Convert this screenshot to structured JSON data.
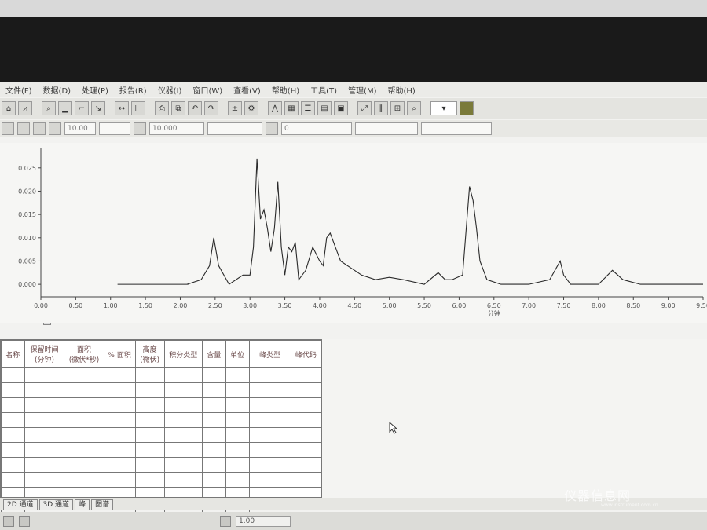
{
  "menu": [
    "文件(F)",
    "数据(D)",
    "处理(P)",
    "报告(R)",
    "仪器(I)",
    "窗口(W)",
    "查看(V)",
    "帮助(H)",
    "工具(T)",
    "管理(M)",
    "帮助(H)"
  ],
  "toolbar2": {
    "field1": "10.00",
    "field2": "10.000",
    "field3": "0"
  },
  "chart_data": {
    "type": "line",
    "xlabel": "分钟",
    "x_ticks": [
      "0.00",
      "0.50",
      "1.00",
      "1.50",
      "2.00",
      "2.50",
      "3.00",
      "3.50",
      "4.00",
      "4.50",
      "5.00",
      "5.50",
      "6.00",
      "6.50",
      "7.00",
      "7.50",
      "8.00",
      "8.50",
      "9.00",
      "9.50"
    ],
    "y_ticks": [
      "0.025",
      "0.020",
      "0.015",
      "0.010",
      "0.005",
      "0.000"
    ],
    "xlim": [
      0,
      9.5
    ],
    "ylim": [
      -0.002,
      0.028
    ],
    "series": [
      {
        "x": [
          2.1,
          2.3,
          2.42,
          2.48,
          2.55,
          2.7,
          2.9,
          3.0,
          3.05,
          3.1,
          3.15,
          3.2,
          3.25,
          3.3,
          3.35,
          3.4,
          3.45,
          3.5,
          3.55,
          3.6,
          3.65,
          3.7,
          3.8,
          3.9,
          4.0,
          4.05,
          4.1,
          4.15,
          4.2,
          4.25,
          4.3,
          4.4,
          4.5,
          4.6,
          4.8,
          5.0,
          5.2,
          5.5,
          5.7,
          5.8,
          5.9,
          6.05,
          6.15,
          6.2,
          6.25,
          6.3,
          6.4,
          6.6,
          6.8,
          7.0,
          7.3,
          7.45,
          7.5,
          7.6,
          7.8,
          8.0,
          8.2,
          8.35,
          8.6,
          9.0,
          9.5
        ],
        "y": [
          0.0,
          0.001,
          0.004,
          0.01,
          0.004,
          0.0,
          0.002,
          0.002,
          0.008,
          0.027,
          0.014,
          0.016,
          0.012,
          0.007,
          0.012,
          0.022,
          0.008,
          0.002,
          0.008,
          0.007,
          0.009,
          0.001,
          0.003,
          0.008,
          0.005,
          0.004,
          0.01,
          0.011,
          0.009,
          0.007,
          0.005,
          0.004,
          0.003,
          0.002,
          0.001,
          0.0015,
          0.001,
          0.0,
          0.0025,
          0.001,
          0.001,
          0.002,
          0.021,
          0.018,
          0.012,
          0.005,
          0.001,
          0.0,
          0.0,
          0.0,
          0.001,
          0.005,
          0.002,
          0.0,
          0.0,
          0.0,
          0.003,
          0.001,
          0.0,
          0.0,
          0.0
        ]
      }
    ]
  },
  "table": {
    "headers": [
      "名称",
      "保留时间\n(分钟)",
      "面积\n(微伏*秒)",
      "% 面积",
      "高度\n(微伏)",
      "积分类型",
      "含量",
      "单位",
      "峰类型",
      "峰代码"
    ],
    "rows": 12
  },
  "tabs": [
    "2D 通道",
    "3D 通道",
    "峰",
    "图谱"
  ],
  "status": {
    "field": "1.00"
  },
  "watermark": {
    "text": "仪器信息网",
    "sub": "www.instrument.com.cn"
  },
  "colors": {
    "trace": "#2a2a2a",
    "table_text": "#6a4a4a"
  }
}
